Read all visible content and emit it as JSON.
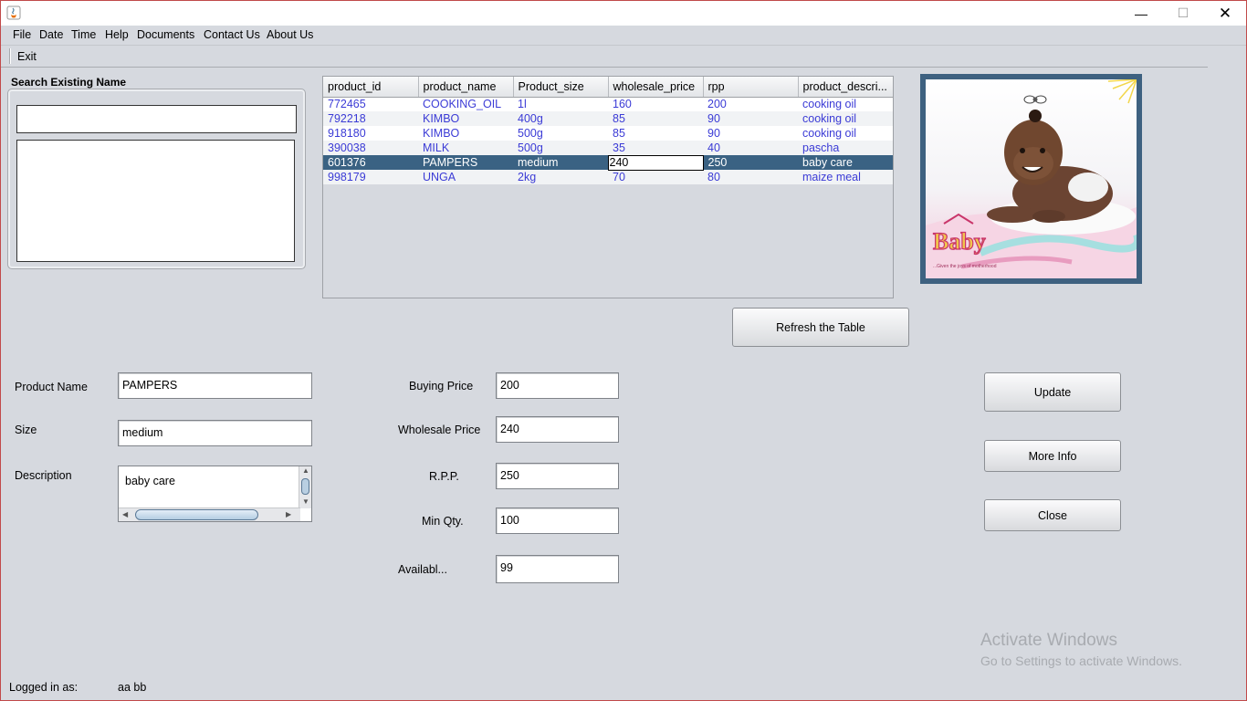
{
  "window": {
    "controls": {
      "minimize": "—",
      "maximize": "☐",
      "close": "✕"
    }
  },
  "menu": [
    "File",
    "Date",
    "Time",
    "Help",
    "Documents",
    "Contact Us",
    "About Us"
  ],
  "toolbar": {
    "exit_label": "Exit"
  },
  "search": {
    "title": "Search Existing  Name",
    "query": ""
  },
  "table": {
    "columns": [
      "product_id",
      "product_name",
      "Product_size",
      "wholesale_price",
      "rpp",
      "product_descri..."
    ],
    "rows": [
      [
        "772465",
        "COOKING_OIL",
        "1l",
        "160",
        "200",
        "cooking oil"
      ],
      [
        "792218",
        "KIMBO",
        "400g",
        "85",
        "90",
        "cooking oil"
      ],
      [
        "918180",
        "KIMBO",
        "500g",
        "85",
        "90",
        "cooking oil"
      ],
      [
        "390038",
        "MILK",
        "500g",
        "35",
        "40",
        "pascha"
      ],
      [
        "601376",
        "PAMPERS",
        "medium",
        "240",
        "250",
        "baby care"
      ],
      [
        "998179",
        "UNGA",
        "2kg",
        "70",
        "80",
        "maize meal"
      ]
    ],
    "selected_row_index": 4,
    "editing_column_index": 3
  },
  "image": {
    "brand_text": "Baby",
    "tagline": "...Given the joys of motherhood"
  },
  "buttons": {
    "refresh": "Refresh  the Table",
    "update": "Update",
    "more_info": "More Info",
    "close": "Close"
  },
  "form": {
    "product_name_label": "Product Name",
    "product_name": "PAMPERS",
    "size_label": "Size",
    "size": "medium",
    "description_label": "Description",
    "description": "baby care",
    "buying_price_label": "Buying Price",
    "buying_price": "200",
    "wholesale_price_label": "Wholesale Price",
    "wholesale_price": "240",
    "rpp_label": "R.P.P.",
    "rpp": "250",
    "min_qty_label": "Min Qty.",
    "min_qty": "100",
    "available_label": "Availabl...",
    "available": "99"
  },
  "footer": {
    "logged_in_label": "Logged in as:",
    "user": "aa bb"
  },
  "watermark": {
    "line1": "Activate Windows",
    "line2": "Go to Settings to activate Windows."
  }
}
